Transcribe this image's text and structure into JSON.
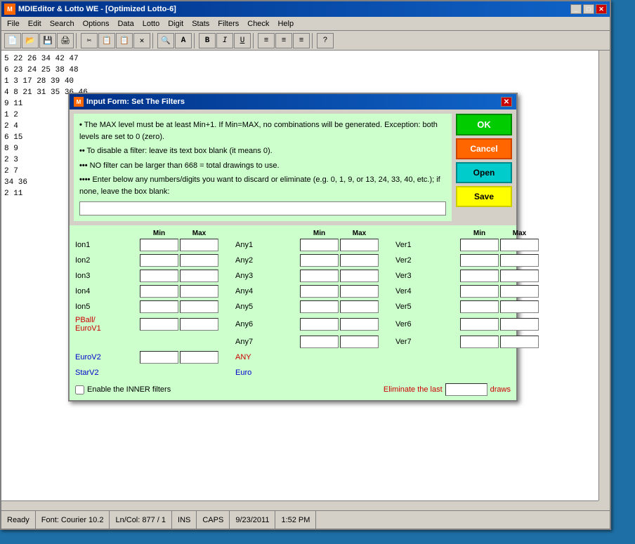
{
  "window": {
    "title": "MDIEditor & Lotto WE - [Optimized Lotto-6]",
    "icon": "M"
  },
  "titlebar": {
    "minimize": "_",
    "maximize": "□",
    "close": "✕"
  },
  "menu": {
    "items": [
      "File",
      "Edit",
      "Search",
      "Options",
      "Data",
      "Lotto",
      "Digit",
      "Stats",
      "Filters",
      "Check",
      "Help"
    ]
  },
  "toolbar": {
    "buttons": [
      "📁",
      "💾",
      "🖨",
      "✂",
      "📋",
      "❌",
      "🔍",
      "A",
      "B",
      "I",
      "U",
      "≡",
      "≡",
      "≡",
      "?"
    ]
  },
  "content": {
    "lines": [
      "   5  22  26  34  42  47",
      "   6  23  24  25  38  48",
      "   1   3  17  28  39  40",
      "   4   8  21  31  35  36  46",
      "   9  11",
      "   1   2",
      "   2   4",
      "   6  15",
      "   8   9",
      "   2   3",
      "   2   7",
      "  34  36",
      "   2  11"
    ]
  },
  "dialog": {
    "title": "Input Form: Set The Filters",
    "icon": "M",
    "close_btn": "✕",
    "info_lines": [
      "• The MAX level must be at least Min+1. If Min=MAX, no combinations will be generated.  Exception: both levels are set to 0 (zero).",
      "•• To disable a filter: leave its text box blank (it means 0).",
      "••• NO filter can be larger than 668 = total drawings to use.",
      "•••• Enter below any numbers/digits you want to discard or eliminate  (e.g.  0, 1, 9, or 13, 24, 33, 40, etc.);  if none, leave the box blank:"
    ],
    "buttons": {
      "ok": "OK",
      "cancel": "Cancel",
      "open": "Open",
      "save": "Save"
    },
    "filter_input": "",
    "grid": {
      "col_headers_1": [
        "",
        "Min",
        "Max"
      ],
      "col_headers_2": [
        "",
        "Min",
        "Max"
      ],
      "col_headers_3": [
        "",
        "Min",
        "Max"
      ],
      "rows": [
        {
          "label1": "Ion1",
          "label1_class": "black",
          "label2": "Any1",
          "label2_class": "black",
          "label3": "Ver1",
          "label3_class": "black"
        },
        {
          "label1": "Ion2",
          "label1_class": "black",
          "label2": "Any2",
          "label2_class": "black",
          "label3": "Ver2",
          "label3_class": "black"
        },
        {
          "label1": "Ion3",
          "label1_class": "black",
          "label2": "Any3",
          "label2_class": "black",
          "label3": "Ver3",
          "label3_class": "black"
        },
        {
          "label1": "Ion4",
          "label1_class": "black",
          "label2": "Any4",
          "label2_class": "black",
          "label3": "Ver4",
          "label3_class": "black"
        },
        {
          "label1": "Ion5",
          "label1_class": "black",
          "label2": "Any5",
          "label2_class": "black",
          "label3": "Ver5",
          "label3_class": "black"
        },
        {
          "label1": "PBall/ EuroV1",
          "label1_class": "red",
          "label2": "Any6",
          "label2_class": "black",
          "label3": "Ver6",
          "label3_class": "black"
        },
        {
          "label1": "",
          "label1_class": "black",
          "label2": "Any7",
          "label2_class": "black",
          "label3": "Ver7",
          "label3_class": "black"
        },
        {
          "label1": "EuroV2",
          "label1_class": "blue",
          "label2": "ANY",
          "label2_class": "red",
          "label3": "",
          "label3_class": "black"
        },
        {
          "label1": "StarV2",
          "label1_class": "blue",
          "label2": "Euro",
          "label2_class": "blue",
          "label3": "",
          "label3_class": "black"
        }
      ]
    },
    "footer": {
      "enable_inner": "Enable the INNER filters",
      "eliminate_last": "Eliminate the last",
      "draws": "draws",
      "draws_value": ""
    }
  },
  "statusbar": {
    "ready": "Ready",
    "font": "Font: Courier 10.2",
    "lncol": "Ln/Col: 877 / 1",
    "ins": "INS",
    "caps": "CAPS",
    "date": "9/23/2011",
    "time": "1:52 PM"
  }
}
